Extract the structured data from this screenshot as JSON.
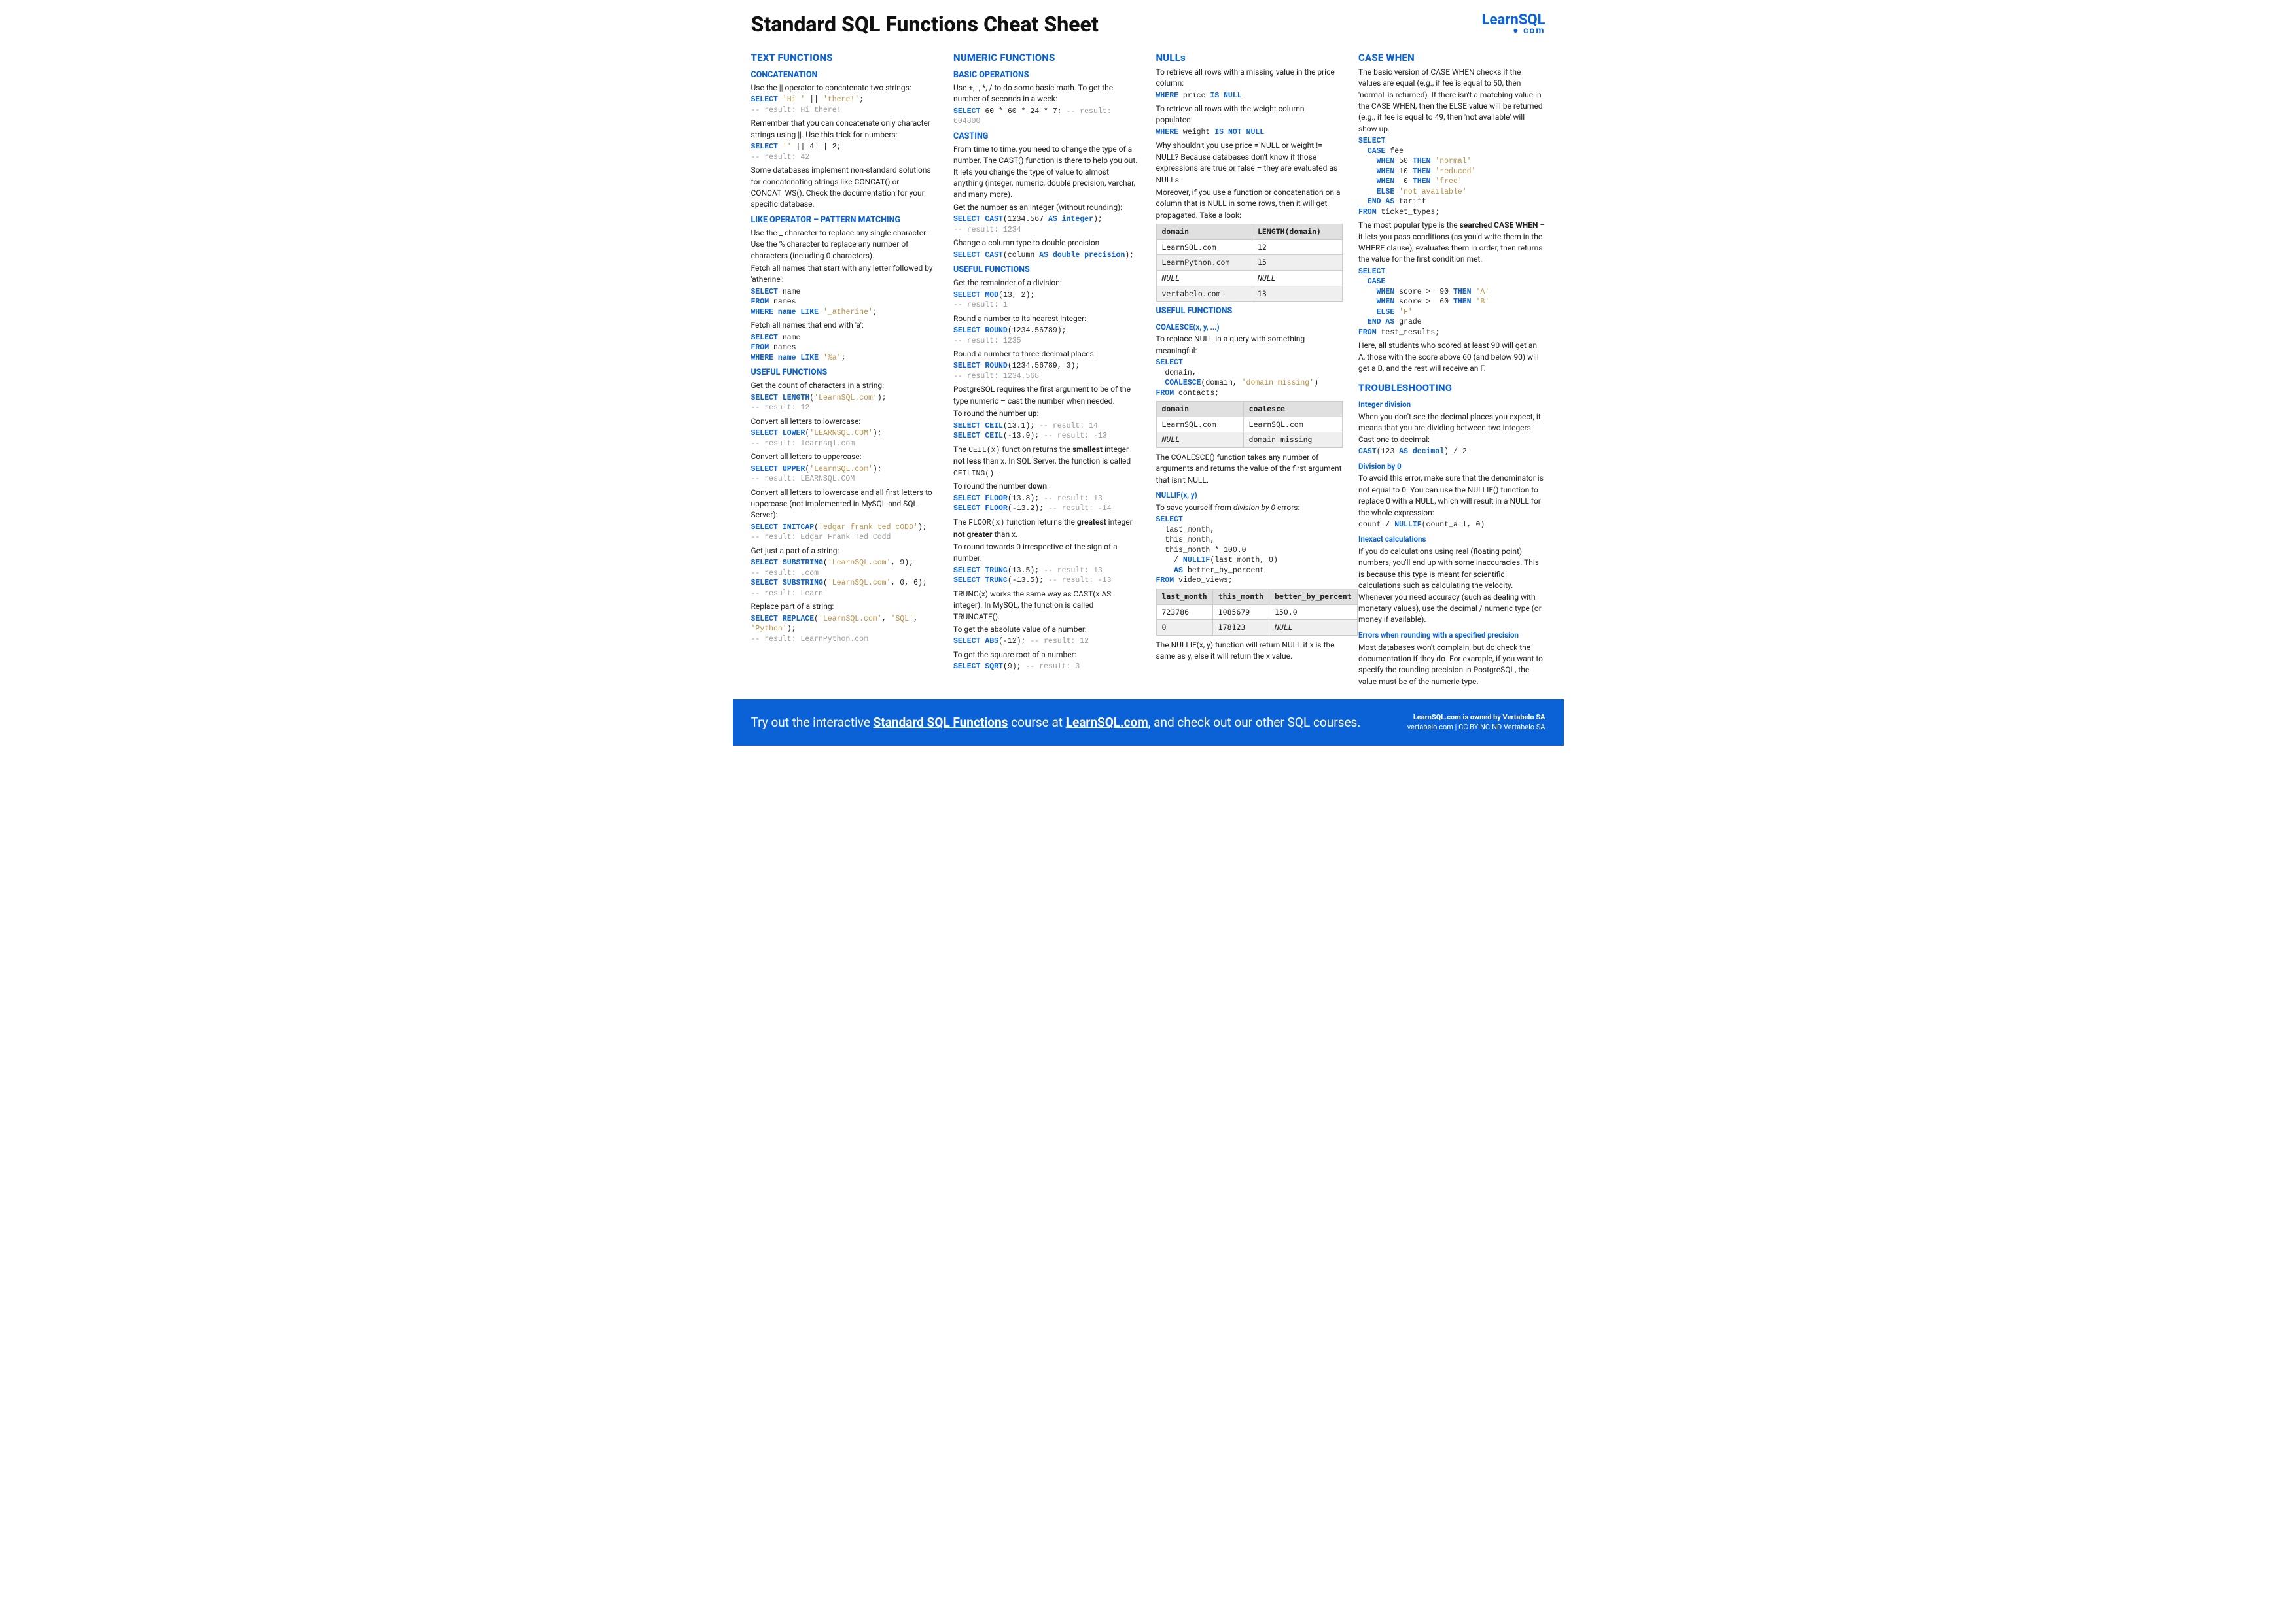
{
  "title": "Standard SQL Functions Cheat Sheet",
  "logo": {
    "main": "LearnSQL",
    "sub": "● com"
  },
  "col1": {
    "h_text": "TEXT FUNCTIONS",
    "h_concat": "CONCATENATION",
    "concat_p1": "Use the || operator to concatenate two strings:",
    "concat_p2": "Remember that you can concatenate only character strings using ||. Use this trick for numbers:",
    "concat_p3": "Some databases implement non-standard solutions for concatenating strings like CONCAT() or CONCAT_WS(). Check the documentation for your specific database.",
    "h_like": "LIKE OPERATOR – PATTERN MATCHING",
    "like_p1": "Use the _ character to replace any single character. Use the % character to replace any number of characters (including 0 characters).",
    "like_p2": "Fetch all names that start with any letter followed by 'atherine':",
    "like_p3": "Fetch all names that end with 'a':",
    "h_useful": "USEFUL FUNCTIONS",
    "uf_p1": "Get the count of characters in a string:",
    "uf_p2": "Convert all letters to lowercase:",
    "uf_p3": "Convert all letters to uppercase:",
    "uf_p4": "Convert all letters to lowercase and all first letters to uppercase (not implemented in MySQL and SQL Server):",
    "uf_p5": "Get just a part of a string:",
    "uf_p6": "Replace part of a string:"
  },
  "col2": {
    "h_num": "NUMERIC FUNCTIONS",
    "h_basic": "BASIC OPERATIONS",
    "basic_p1": "Use +, -, *, / to do some basic math. To get the number of seconds in a week:",
    "h_cast": "CASTING",
    "cast_p1": "From time to time, you need to change the type of a number. The CAST() function is there to help you out. It lets you change the type of value to almost anything (integer, numeric, double precision, varchar, and many more).",
    "cast_p2": "Get the number as an integer (without rounding):",
    "cast_p3": "Change a column type to double precision",
    "h_useful": "USEFUL FUNCTIONS",
    "uf_p1": "Get the remainder of a division:",
    "uf_p2": "Round a number to its nearest integer:",
    "uf_p3": "Round a number to three decimal places:",
    "uf_p4": "PostgreSQL requires the first argument to be of the type numeric – cast the number when needed.",
    "uf_p5a": "To round the number ",
    "uf_p5b": "up",
    "uf_p5c": ":",
    "uf_ceil": "The CEIL(x) function returns the smallest integer not less than x. In SQL Server, the function is called CEILING().",
    "uf_p6a": "To round the number ",
    "uf_p6b": "down",
    "uf_p6c": ":",
    "uf_floor": "The FLOOR(x) function returns the greatest integer not greater than x.",
    "uf_p7": "To round towards 0 irrespective of the sign of a number:",
    "uf_trunc": "TRUNC(x) works the same way as CAST(x AS integer). In MySQL, the function is called TRUNCATE().",
    "uf_p8": "To get the absolute value of a number:",
    "uf_p9": "To get the square root of a number:"
  },
  "col3": {
    "h_nulls": "NULLs",
    "nulls_p1": "To retrieve all rows with a missing value in the price column:",
    "nulls_p2": "To retrieve all rows with the weight column populated:",
    "nulls_p3": "Why shouldn't you use price = NULL or weight != NULL? Because databases don't know if those expressions are true or false – they are evaluated as NULLs.",
    "nulls_p4": "Moreover, if you use a function or concatenation on a column that is NULL in some rows, then it will get propagated. Take a look:",
    "table1": {
      "headers": [
        "domain",
        "LENGTH(domain)"
      ],
      "rows": [
        [
          "LearnSQL.com",
          "12"
        ],
        [
          "LearnPython.com",
          "15"
        ],
        [
          "NULL",
          "NULL"
        ],
        [
          "vertabelo.com",
          "13"
        ]
      ]
    },
    "h_useful": "USEFUL FUNCTIONS",
    "h_coalesce": "COALESCE(x, y, ...)",
    "coalesce_p1": "To replace NULL in a query with something meaningful:",
    "table2": {
      "headers": [
        "domain",
        "coalesce"
      ],
      "rows": [
        [
          "LearnSQL.com",
          "LearnSQL.com"
        ],
        [
          "NULL",
          "domain missing"
        ]
      ]
    },
    "coalesce_p2": "The COALESCE() function takes any number of arguments and returns the value of the first argument that isn't NULL.",
    "h_nullif": "NULLIF(x, y)",
    "nullif_p1": "To save yourself from division by 0 errors:",
    "table3": {
      "headers": [
        "last_month",
        "this_month",
        "better_by_percent"
      ],
      "rows": [
        [
          "723786",
          "1085679",
          "150.0"
        ],
        [
          "0",
          "178123",
          "NULL"
        ]
      ]
    },
    "nullif_p2": "The NULLIF(x, y) function will return NULL if x is the same as y, else it will return the x value."
  },
  "col4": {
    "h_case": "CASE WHEN",
    "case_p1": "The basic version of CASE WHEN checks if the values are equal (e.g., if fee is equal to 50, then 'normal' is returned). If there isn't a matching value in the CASE WHEN, then the ELSE value will be returned (e.g., if fee is equal to 49, then 'not available' will show up.",
    "case_p2a": "The most popular type is the ",
    "case_p2b": "searched CASE WHEN",
    "case_p2c": " – it lets you pass conditions (as you'd write them in the WHERE clause), evaluates them in order, then returns the value for the first condition met.",
    "case_p3": "Here, all students who scored at least 90 will get an A, those with the score above 60 (and below 90) will get a B, and the rest will receive an F.",
    "h_trouble": "TROUBLESHOOTING",
    "h_intdiv": "Integer division",
    "intdiv_p": "When you don't see the decimal places you expect, it means that you are dividing between two integers. Cast one to decimal:",
    "h_div0": "Division by 0",
    "div0_p": "To avoid this error, make sure that the denominator is not equal to 0. You can use the NULLIF() function to replace 0 with a NULL, which will result in a NULL for the whole expression:",
    "h_inexact": "Inexact calculations",
    "inexact_p": "If you do calculations using real (floating point) numbers, you'll end up with some inaccuracies. This is because this type is meant for scientific calculations such as calculating the velocity. Whenever you need accuracy (such as dealing with monetary values), use the decimal / numeric type (or money if available).",
    "h_round": "Errors when rounding with a specified precision",
    "round_p": "Most databases won't complain, but do check the documentation if they do. For example, if you want to specify the rounding precision in PostgreSQL, the value must be of the numeric type."
  },
  "footer": {
    "text1": "Try out the interactive ",
    "link1": "Standard SQL Functions",
    "text2": " course at ",
    "link2": "LearnSQL.com",
    "text3": ", and check out our other SQL courses.",
    "r1": "LearnSQL.com is owned by Vertabelo SA",
    "r2": "vertabelo.com | CC BY-NC-ND Vertabelo SA"
  }
}
